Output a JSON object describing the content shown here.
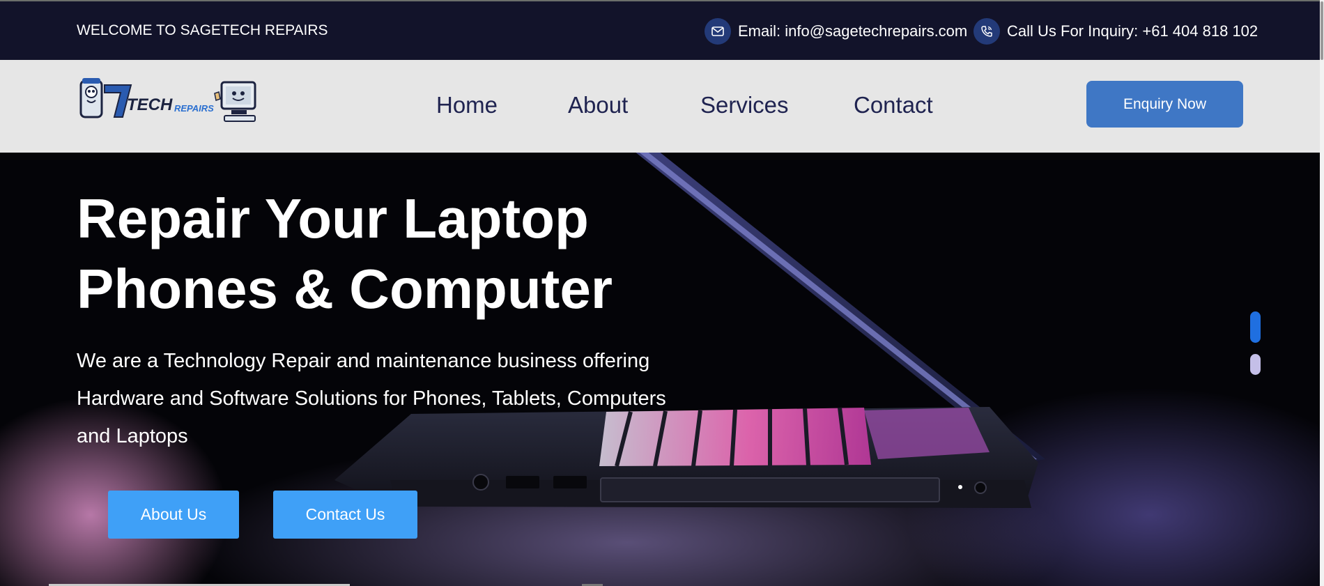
{
  "topbar": {
    "welcome": "WELCOME TO SAGETECH REPAIRS",
    "email_text": "Email: info@sagetechrepairs.com",
    "phone_text": "Call Us For Inquiry: +61 404 818 102",
    "email_icon": "mail-icon",
    "phone_icon": "phone-icon"
  },
  "nav": {
    "logo_text_main": "TECH",
    "logo_text_sub": "REPAIRS",
    "items": [
      {
        "label": "Home"
      },
      {
        "label": "About"
      },
      {
        "label": "Services"
      },
      {
        "label": "Contact"
      }
    ],
    "enquiry_label": "Enquiry Now"
  },
  "hero": {
    "title_line1": "Repair Your Laptop",
    "title_line2": "Phones & Computer",
    "description": "We are a Technology Repair and maintenance business offering Hardware and Software Solutions for Phones, Tablets, Computers and Laptops",
    "about_button": "About Us",
    "contact_button": "Contact Us",
    "slide_count": 2,
    "active_slide": 1
  },
  "colors": {
    "topbar_bg": "#12132a",
    "nav_bg": "#e6e6e6",
    "nav_text": "#1f2350",
    "enquiry_bg": "#3f77c5",
    "hero_button_bg": "#3fa0f7",
    "dot_active": "#1f6fe0",
    "dot_inactive": "#c4bfe8"
  }
}
